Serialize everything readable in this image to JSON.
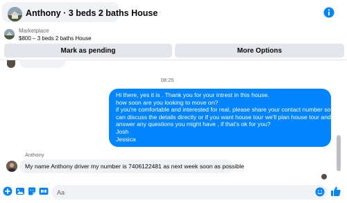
{
  "header": {
    "title": "Anthony · 3 beds 2 baths House"
  },
  "listing": {
    "source": "Marketplace",
    "title": "$800 – 3 beds 2 baths House"
  },
  "actions": {
    "mark_pending": "Mark as pending",
    "more_options": "More Options"
  },
  "conversation": {
    "timestamp": "08:25",
    "outgoing": {
      "lines": [
        "Hi there, yes it is . Thank you for your intrest in this house.",
        "how soon are you looking to move on?",
        "if you're comfortable and interested for real, please share your contact number so we",
        "can discuss the details directly or if you  want house tour we'll plan house tour and",
        "answer any questions you might have , if that's ok for you?",
        "Josh",
        "Jessica"
      ]
    },
    "incoming": {
      "sender": "Anthony",
      "text": "My name Anthony driver my number is 7406122481 as next week soon as possible"
    }
  },
  "composer": {
    "placeholder": "Aa"
  },
  "icons": {
    "header": [
      "info-icon"
    ],
    "composer": [
      "plus-icon",
      "photo-icon",
      "sticker-icon",
      "gif-icon",
      "emoji-icon",
      "like-icon"
    ]
  },
  "colors": {
    "accent": "#0084ff",
    "bubble_incoming": "#f0f2f5",
    "button_bg": "#e4e6eb"
  }
}
